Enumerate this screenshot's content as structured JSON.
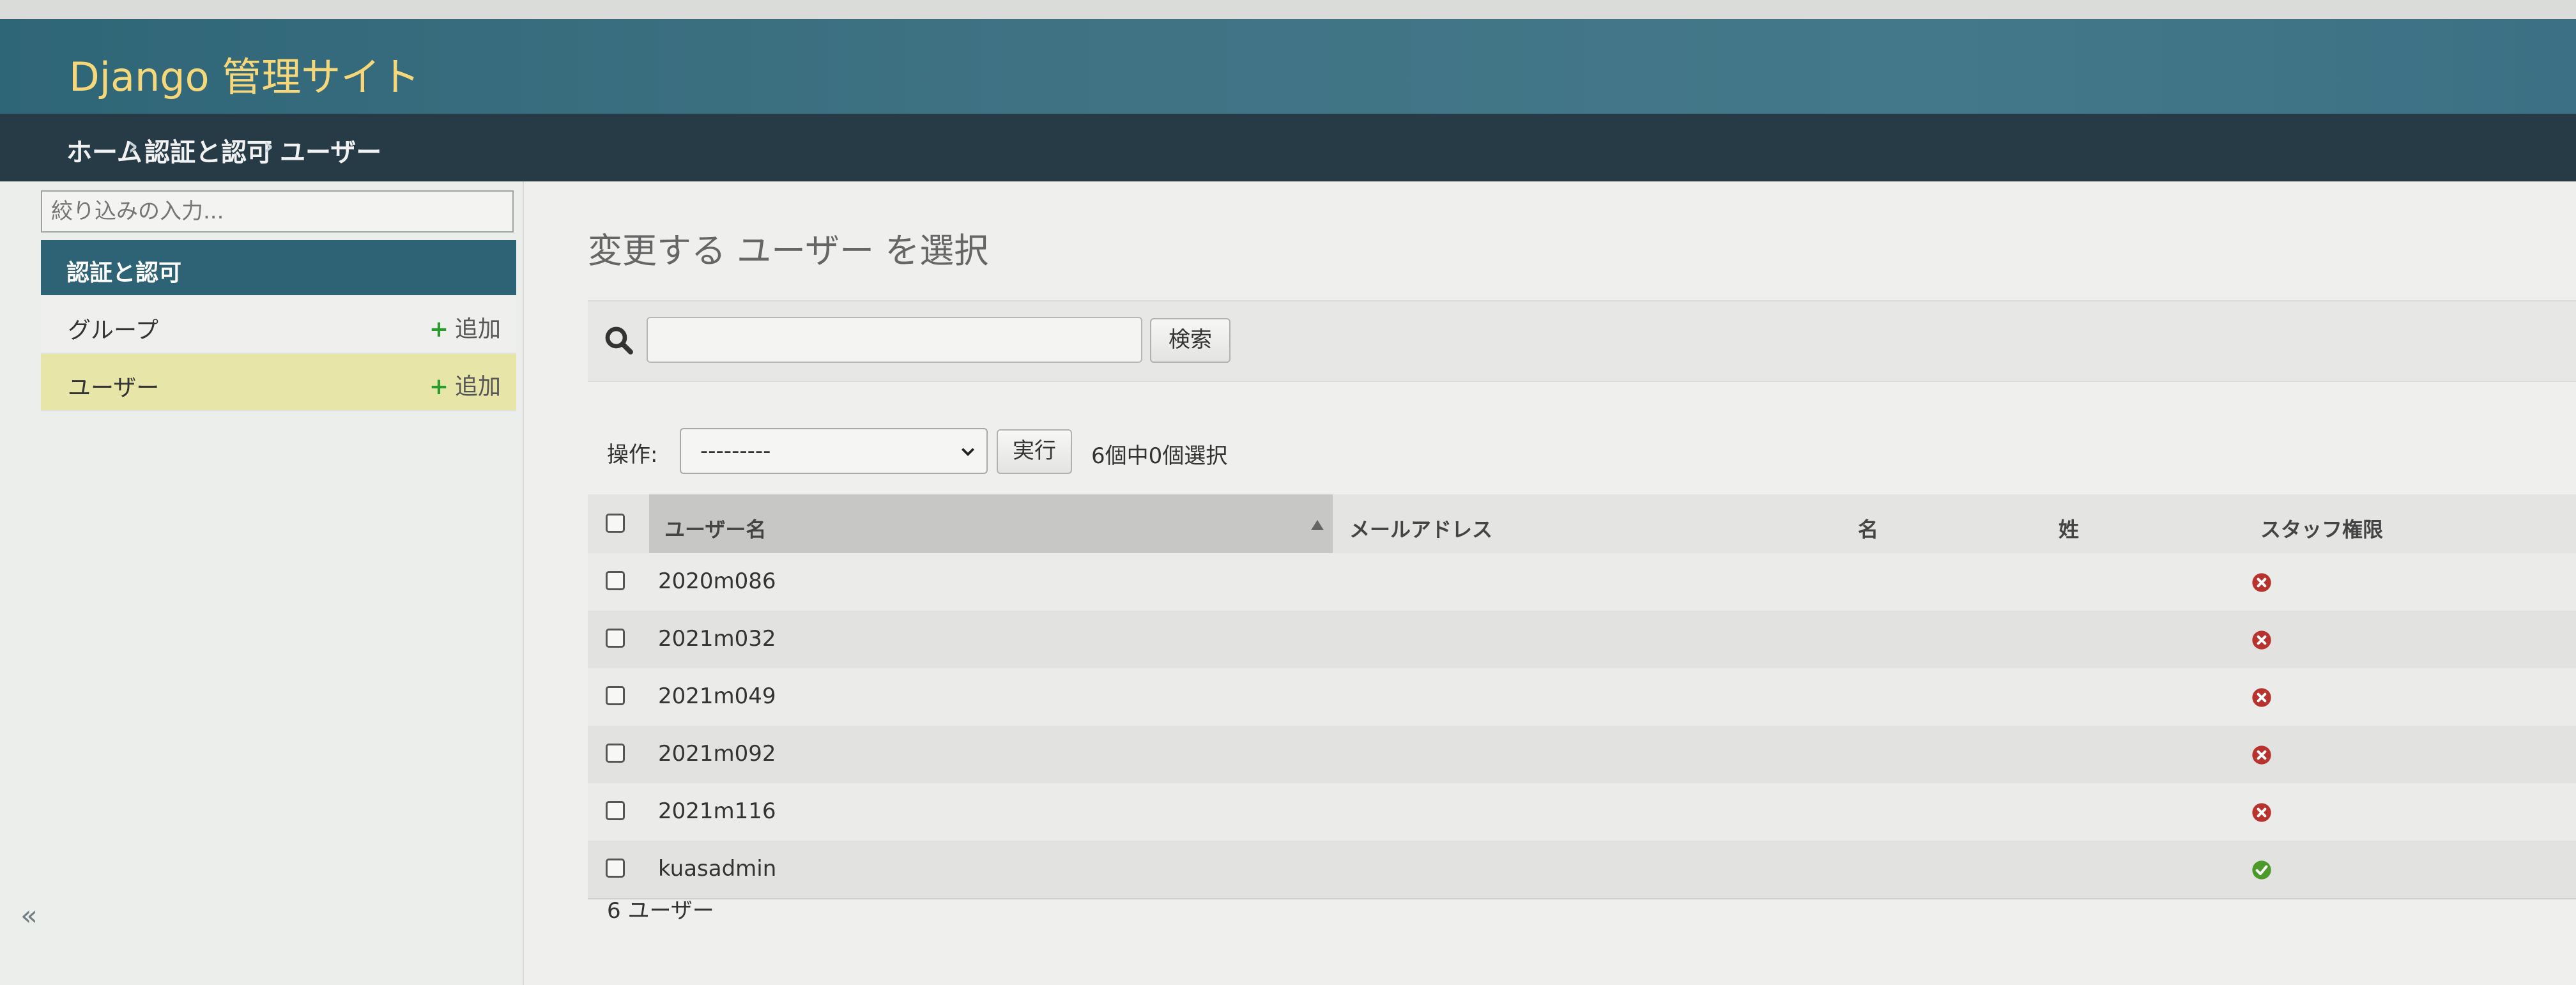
{
  "header": {
    "branding": "Django 管理サイト"
  },
  "breadcrumbs": {
    "home": "ホーム",
    "app": "認証と認可",
    "current": "ユーザー",
    "separator": "›"
  },
  "sidebar": {
    "filter_placeholder": "絞り込みの入力...",
    "app_caption": "認証と認可",
    "items": [
      {
        "label": "グループ",
        "add_label": "追加"
      },
      {
        "label": "ユーザー",
        "add_label": "追加",
        "selected": true
      }
    ],
    "add_icon": "+",
    "collapse_label": "«"
  },
  "main": {
    "title": "変更する ユーザー を選択",
    "search": {
      "value": "",
      "button_label": "検索"
    },
    "actions": {
      "label": "操作:",
      "select_value": "---------",
      "run_label": "実行",
      "counter": "6個中0個選択"
    },
    "table": {
      "columns": [
        "ユーザー名",
        "メールアドレス",
        "名",
        "姓",
        "スタッフ権限"
      ],
      "rows": [
        {
          "username": "2020m086",
          "email": "",
          "first_name": "",
          "last_name": "",
          "staff": false
        },
        {
          "username": "2021m032",
          "email": "",
          "first_name": "",
          "last_name": "",
          "staff": false
        },
        {
          "username": "2021m049",
          "email": "",
          "first_name": "",
          "last_name": "",
          "staff": false
        },
        {
          "username": "2021m092",
          "email": "",
          "first_name": "",
          "last_name": "",
          "staff": false
        },
        {
          "username": "2021m116",
          "email": "",
          "first_name": "",
          "last_name": "",
          "staff": false
        },
        {
          "username": "kuasadmin",
          "email": "",
          "first_name": "",
          "last_name": "",
          "staff": true
        }
      ]
    },
    "paginator": "6 ユーザー"
  },
  "colors": {
    "header": "#3f7384",
    "breadcrumbs": "#263b45",
    "branding": "#f6d87a",
    "selected_row": "#e8e5a8",
    "add_plus": "#2a9b2d",
    "status_no": "#b8332d",
    "status_yes": "#4c9a2a"
  }
}
